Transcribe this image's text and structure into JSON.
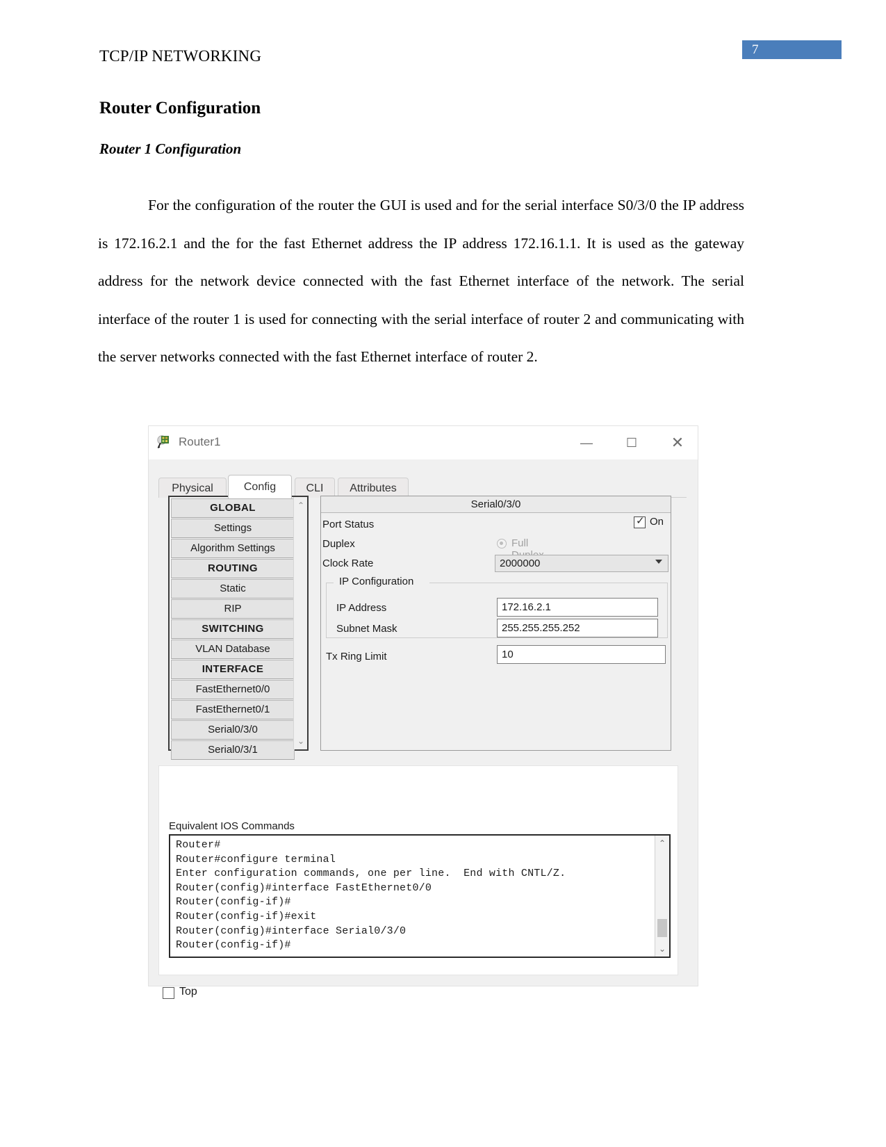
{
  "document": {
    "header_title": "TCP/IP NETWORKING",
    "page_number": "7",
    "page_number_color": "#4a7ebb",
    "heading1": "Router Configuration",
    "heading2": "Router 1 Configuration",
    "paragraph": "For the configuration of the router the GUI is used and for the serial interface S0/3/0 the IP address is 172.16.2.1 and the for the fast Ethernet address the IP address 172.16.1.1. It is used as the gateway address for the network device connected with the fast Ethernet interface of the network. The serial interface of the router 1 is used for connecting with the serial interface of router 2 and communicating with the server networks connected with the fast Ethernet interface of router 2."
  },
  "window": {
    "title": "Router1",
    "icon": "router-device-icon",
    "minimize_label": "—",
    "maximize_label": "☐",
    "close_label": "✕",
    "tabs": [
      {
        "label": "Physical",
        "active": false
      },
      {
        "label": "Config",
        "active": true
      },
      {
        "label": "CLI",
        "active": false
      },
      {
        "label": "Attributes",
        "active": false
      }
    ],
    "nav": {
      "items": [
        {
          "label": "GLOBAL",
          "type": "section"
        },
        {
          "label": "Settings",
          "type": "item"
        },
        {
          "label": "Algorithm Settings",
          "type": "item"
        },
        {
          "label": "ROUTING",
          "type": "section"
        },
        {
          "label": "Static",
          "type": "item"
        },
        {
          "label": "RIP",
          "type": "item"
        },
        {
          "label": "SWITCHING",
          "type": "section"
        },
        {
          "label": "VLAN Database",
          "type": "item"
        },
        {
          "label": "INTERFACE",
          "type": "section"
        },
        {
          "label": "FastEthernet0/0",
          "type": "item"
        },
        {
          "label": "FastEthernet0/1",
          "type": "item"
        },
        {
          "label": "Serial0/3/0",
          "type": "item"
        },
        {
          "label": "Serial0/3/1",
          "type": "item"
        }
      ],
      "scroll_up": "⌃",
      "scroll_down": "⌄"
    },
    "settings": {
      "panel_title": "Serial0/3/0",
      "port_status_label": "Port Status",
      "port_status_on_label": "On",
      "port_status_checked": true,
      "duplex_label": "Duplex",
      "duplex_value": "Full Duplex",
      "clock_rate_label": "Clock Rate",
      "clock_rate_value": "2000000",
      "ip_config_legend": "IP Configuration",
      "ip_address_label": "IP Address",
      "ip_address_value": "172.16.2.1",
      "subnet_mask_label": "Subnet Mask",
      "subnet_mask_value": "255.255.255.252",
      "tx_ring_limit_label": "Tx Ring Limit",
      "tx_ring_limit_value": "10"
    },
    "ios": {
      "label": "Equivalent IOS Commands",
      "lines": "Router#\nRouter#configure terminal\nEnter configuration commands, one per line.  End with CNTL/Z.\nRouter(config)#interface FastEthernet0/0\nRouter(config-if)#\nRouter(config-if)#exit\nRouter(config)#interface Serial0/3/0\nRouter(config-if)#",
      "scroll_up": "⌃",
      "scroll_down": "⌄"
    },
    "footer": {
      "top_label": "Top",
      "top_checked": false
    }
  }
}
